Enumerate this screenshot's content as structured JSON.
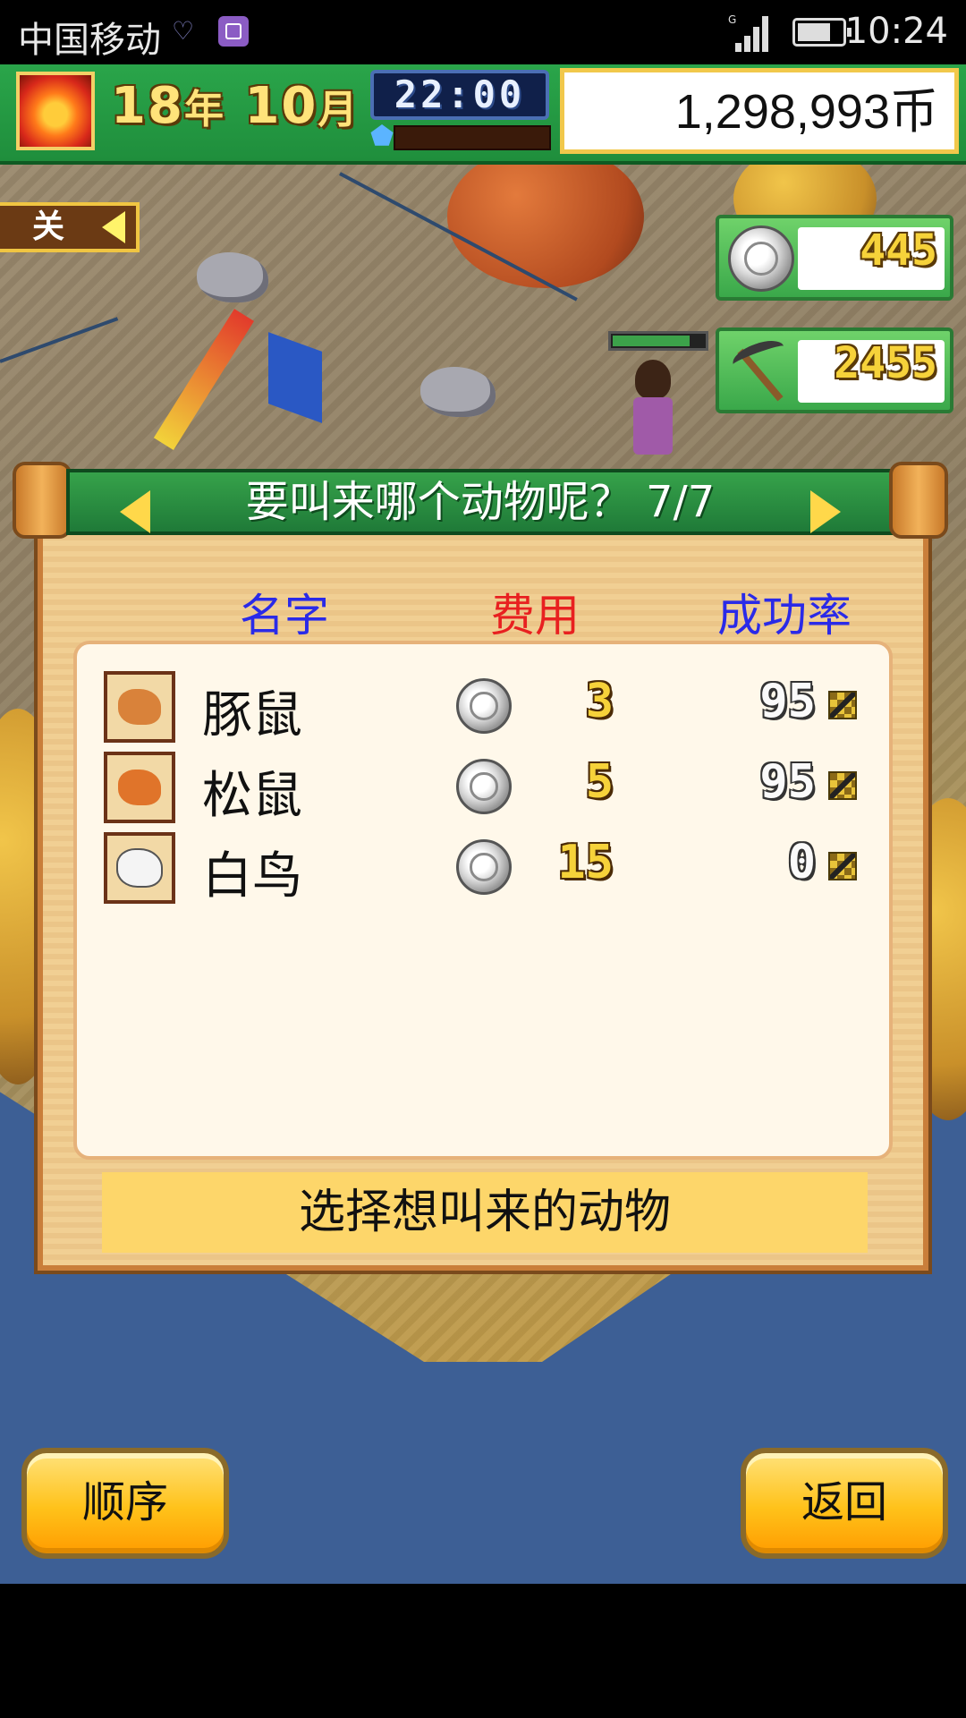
{
  "status_bar": {
    "carrier": "中国移动",
    "network_label": "G",
    "time": "10:24"
  },
  "hud": {
    "year": "18",
    "year_unit": "年",
    "month": "10",
    "month_unit": "月",
    "clock": "22:00",
    "money": "1,298,993币"
  },
  "side": {
    "close_label": "关",
    "coins": "445",
    "pickaxe": "2455"
  },
  "dialog": {
    "title": "要叫来哪个动物呢？ 7/7",
    "col_name": "名字",
    "col_cost": "费用",
    "col_rate": "成功率",
    "hint": "选择想叫来的动物",
    "animals": [
      {
        "name": "豚鼠",
        "cost": "3",
        "rate": "95",
        "color": "#d9823a"
      },
      {
        "name": "松鼠",
        "cost": "5",
        "rate": "95",
        "color": "#e0742a"
      },
      {
        "name": "白鸟",
        "cost": "15",
        "rate": "0",
        "color": "#f4f4f4"
      }
    ]
  },
  "buttons": {
    "order": "顺序",
    "back": "返回"
  }
}
